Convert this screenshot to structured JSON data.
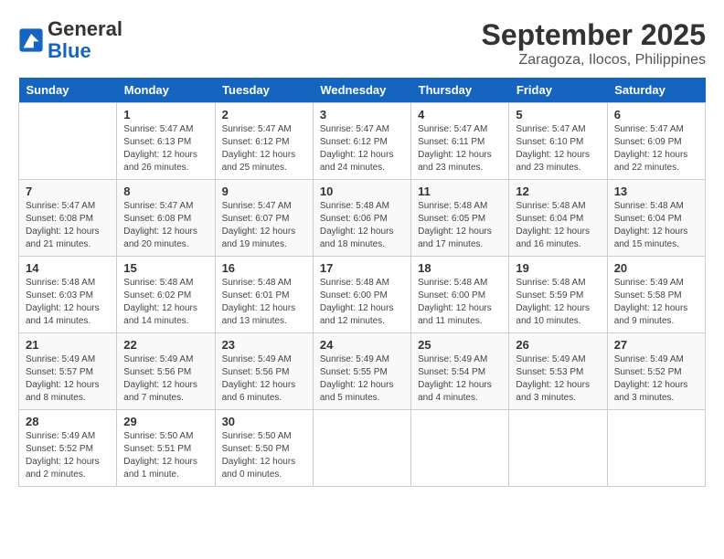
{
  "header": {
    "logo_line1": "General",
    "logo_line2": "Blue",
    "month": "September 2025",
    "location": "Zaragoza, Ilocos, Philippines"
  },
  "days_of_week": [
    "Sunday",
    "Monday",
    "Tuesday",
    "Wednesday",
    "Thursday",
    "Friday",
    "Saturday"
  ],
  "weeks": [
    [
      {
        "num": "",
        "info": ""
      },
      {
        "num": "1",
        "info": "Sunrise: 5:47 AM\nSunset: 6:13 PM\nDaylight: 12 hours\nand 26 minutes."
      },
      {
        "num": "2",
        "info": "Sunrise: 5:47 AM\nSunset: 6:12 PM\nDaylight: 12 hours\nand 25 minutes."
      },
      {
        "num": "3",
        "info": "Sunrise: 5:47 AM\nSunset: 6:12 PM\nDaylight: 12 hours\nand 24 minutes."
      },
      {
        "num": "4",
        "info": "Sunrise: 5:47 AM\nSunset: 6:11 PM\nDaylight: 12 hours\nand 23 minutes."
      },
      {
        "num": "5",
        "info": "Sunrise: 5:47 AM\nSunset: 6:10 PM\nDaylight: 12 hours\nand 23 minutes."
      },
      {
        "num": "6",
        "info": "Sunrise: 5:47 AM\nSunset: 6:09 PM\nDaylight: 12 hours\nand 22 minutes."
      }
    ],
    [
      {
        "num": "7",
        "info": "Sunrise: 5:47 AM\nSunset: 6:08 PM\nDaylight: 12 hours\nand 21 minutes."
      },
      {
        "num": "8",
        "info": "Sunrise: 5:47 AM\nSunset: 6:08 PM\nDaylight: 12 hours\nand 20 minutes."
      },
      {
        "num": "9",
        "info": "Sunrise: 5:47 AM\nSunset: 6:07 PM\nDaylight: 12 hours\nand 19 minutes."
      },
      {
        "num": "10",
        "info": "Sunrise: 5:48 AM\nSunset: 6:06 PM\nDaylight: 12 hours\nand 18 minutes."
      },
      {
        "num": "11",
        "info": "Sunrise: 5:48 AM\nSunset: 6:05 PM\nDaylight: 12 hours\nand 17 minutes."
      },
      {
        "num": "12",
        "info": "Sunrise: 5:48 AM\nSunset: 6:04 PM\nDaylight: 12 hours\nand 16 minutes."
      },
      {
        "num": "13",
        "info": "Sunrise: 5:48 AM\nSunset: 6:04 PM\nDaylight: 12 hours\nand 15 minutes."
      }
    ],
    [
      {
        "num": "14",
        "info": "Sunrise: 5:48 AM\nSunset: 6:03 PM\nDaylight: 12 hours\nand 14 minutes."
      },
      {
        "num": "15",
        "info": "Sunrise: 5:48 AM\nSunset: 6:02 PM\nDaylight: 12 hours\nand 14 minutes."
      },
      {
        "num": "16",
        "info": "Sunrise: 5:48 AM\nSunset: 6:01 PM\nDaylight: 12 hours\nand 13 minutes."
      },
      {
        "num": "17",
        "info": "Sunrise: 5:48 AM\nSunset: 6:00 PM\nDaylight: 12 hours\nand 12 minutes."
      },
      {
        "num": "18",
        "info": "Sunrise: 5:48 AM\nSunset: 6:00 PM\nDaylight: 12 hours\nand 11 minutes."
      },
      {
        "num": "19",
        "info": "Sunrise: 5:48 AM\nSunset: 5:59 PM\nDaylight: 12 hours\nand 10 minutes."
      },
      {
        "num": "20",
        "info": "Sunrise: 5:49 AM\nSunset: 5:58 PM\nDaylight: 12 hours\nand 9 minutes."
      }
    ],
    [
      {
        "num": "21",
        "info": "Sunrise: 5:49 AM\nSunset: 5:57 PM\nDaylight: 12 hours\nand 8 minutes."
      },
      {
        "num": "22",
        "info": "Sunrise: 5:49 AM\nSunset: 5:56 PM\nDaylight: 12 hours\nand 7 minutes."
      },
      {
        "num": "23",
        "info": "Sunrise: 5:49 AM\nSunset: 5:56 PM\nDaylight: 12 hours\nand 6 minutes."
      },
      {
        "num": "24",
        "info": "Sunrise: 5:49 AM\nSunset: 5:55 PM\nDaylight: 12 hours\nand 5 minutes."
      },
      {
        "num": "25",
        "info": "Sunrise: 5:49 AM\nSunset: 5:54 PM\nDaylight: 12 hours\nand 4 minutes."
      },
      {
        "num": "26",
        "info": "Sunrise: 5:49 AM\nSunset: 5:53 PM\nDaylight: 12 hours\nand 3 minutes."
      },
      {
        "num": "27",
        "info": "Sunrise: 5:49 AM\nSunset: 5:52 PM\nDaylight: 12 hours\nand 3 minutes."
      }
    ],
    [
      {
        "num": "28",
        "info": "Sunrise: 5:49 AM\nSunset: 5:52 PM\nDaylight: 12 hours\nand 2 minutes."
      },
      {
        "num": "29",
        "info": "Sunrise: 5:50 AM\nSunset: 5:51 PM\nDaylight: 12 hours\nand 1 minute."
      },
      {
        "num": "30",
        "info": "Sunrise: 5:50 AM\nSunset: 5:50 PM\nDaylight: 12 hours\nand 0 minutes."
      },
      {
        "num": "",
        "info": ""
      },
      {
        "num": "",
        "info": ""
      },
      {
        "num": "",
        "info": ""
      },
      {
        "num": "",
        "info": ""
      }
    ]
  ]
}
